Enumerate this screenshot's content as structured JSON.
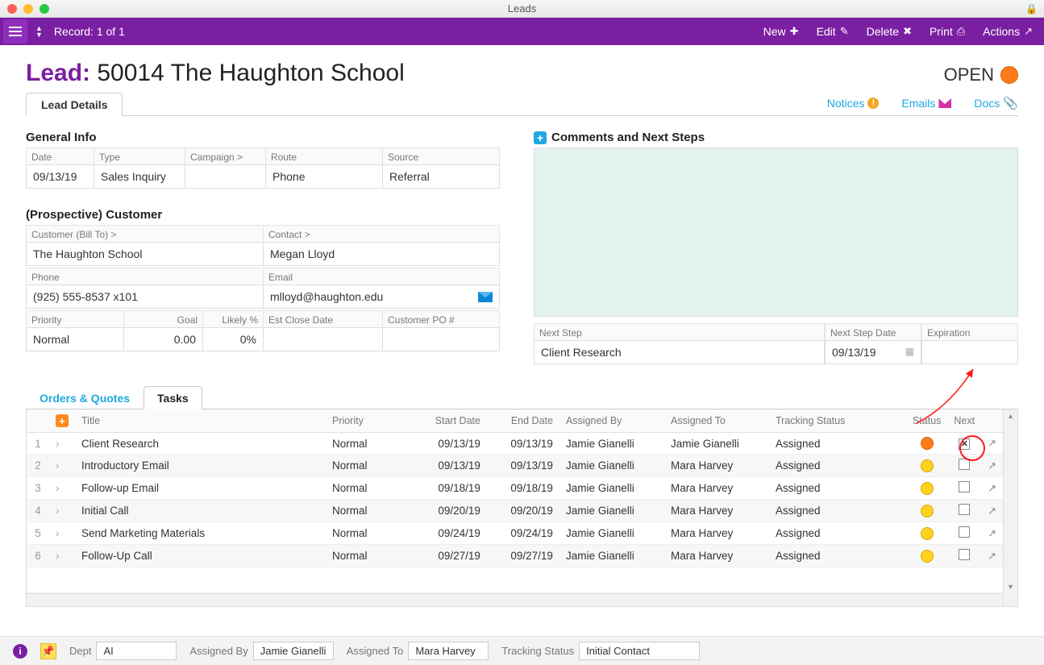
{
  "window": {
    "title": "Leads"
  },
  "toolbar": {
    "record_text": "Record: 1 of 1",
    "new": "New",
    "edit": "Edit",
    "delete": "Delete",
    "print": "Print",
    "actions": "Actions"
  },
  "page": {
    "prefix": "Lead:",
    "id_name": "50014 The Haughton School",
    "status": "OPEN",
    "tab_details": "Lead Details",
    "links": {
      "notices": "Notices",
      "emails": "Emails",
      "docs": "Docs"
    }
  },
  "general_info": {
    "heading": "General Info",
    "date_label": "Date",
    "date": "09/13/19",
    "type_label": "Type",
    "type": "Sales Inquiry",
    "campaign_label": "Campaign >",
    "campaign": "",
    "route_label": "Route",
    "route": "Phone",
    "source_label": "Source",
    "source": "Referral"
  },
  "customer": {
    "heading": "(Prospective) Customer",
    "billto_label": "Customer (Bill To) >",
    "billto": "The Haughton School",
    "contact_label": "Contact >",
    "contact": "Megan Lloyd",
    "phone_label": "Phone",
    "phone": "(925) 555-8537 x101",
    "email_label": "Email",
    "email": "mlloyd@haughton.edu",
    "priority_label": "Priority",
    "priority": "Normal",
    "goal_label": "Goal",
    "goal": "0.00",
    "likely_label": "Likely %",
    "likely": "0%",
    "estclose_label": "Est Close Date",
    "estclose": "",
    "po_label": "Customer PO #",
    "po": ""
  },
  "comments": {
    "heading": "Comments and Next Steps",
    "next_step_label": "Next Step",
    "next_step": "Client Research",
    "next_date_label": "Next Step Date",
    "next_date": "09/13/19",
    "expiration_label": "Expiration",
    "expiration": ""
  },
  "subtabs": {
    "orders": "Orders & Quotes",
    "tasks": "Tasks"
  },
  "task_headers": {
    "title": "Title",
    "priority": "Priority",
    "start": "Start Date",
    "end": "End Date",
    "assigned_by": "Assigned By",
    "assigned_to": "Assigned To",
    "tracking": "Tracking Status",
    "status": "Status",
    "next": "Next"
  },
  "tasks": [
    {
      "n": "1",
      "title": "Client Research",
      "priority": "Normal",
      "start": "09/13/19",
      "end": "09/13/19",
      "by": "Jamie Gianelli",
      "to": "Jamie Gianelli",
      "track": "Assigned",
      "dot": "orange",
      "next": true
    },
    {
      "n": "2",
      "title": "Introductory Email",
      "priority": "Normal",
      "start": "09/13/19",
      "end": "09/13/19",
      "by": "Jamie Gianelli",
      "to": "Mara Harvey",
      "track": "Assigned",
      "dot": "yellow",
      "next": false
    },
    {
      "n": "3",
      "title": "Follow-up Email",
      "priority": "Normal",
      "start": "09/18/19",
      "end": "09/18/19",
      "by": "Jamie Gianelli",
      "to": "Mara Harvey",
      "track": "Assigned",
      "dot": "yellow",
      "next": false
    },
    {
      "n": "4",
      "title": "Initial Call",
      "priority": "Normal",
      "start": "09/20/19",
      "end": "09/20/19",
      "by": "Jamie Gianelli",
      "to": "Mara Harvey",
      "track": "Assigned",
      "dot": "yellow",
      "next": false
    },
    {
      "n": "5",
      "title": "Send Marketing Materials",
      "priority": "Normal",
      "start": "09/24/19",
      "end": "09/24/19",
      "by": "Jamie Gianelli",
      "to": "Mara Harvey",
      "track": "Assigned",
      "dot": "yellow",
      "next": false
    },
    {
      "n": "6",
      "title": "Follow-Up Call",
      "priority": "Normal",
      "start": "09/27/19",
      "end": "09/27/19",
      "by": "Jamie Gianelli",
      "to": "Mara Harvey",
      "track": "Assigned",
      "dot": "yellow",
      "next": false
    }
  ],
  "footer": {
    "dept_label": "Dept",
    "dept": "AI",
    "assigned_by_label": "Assigned By",
    "assigned_by": "Jamie Gianelli",
    "assigned_to_label": "Assigned To",
    "assigned_to": "Mara Harvey",
    "tracking_label": "Tracking Status",
    "tracking": "Initial Contact"
  }
}
